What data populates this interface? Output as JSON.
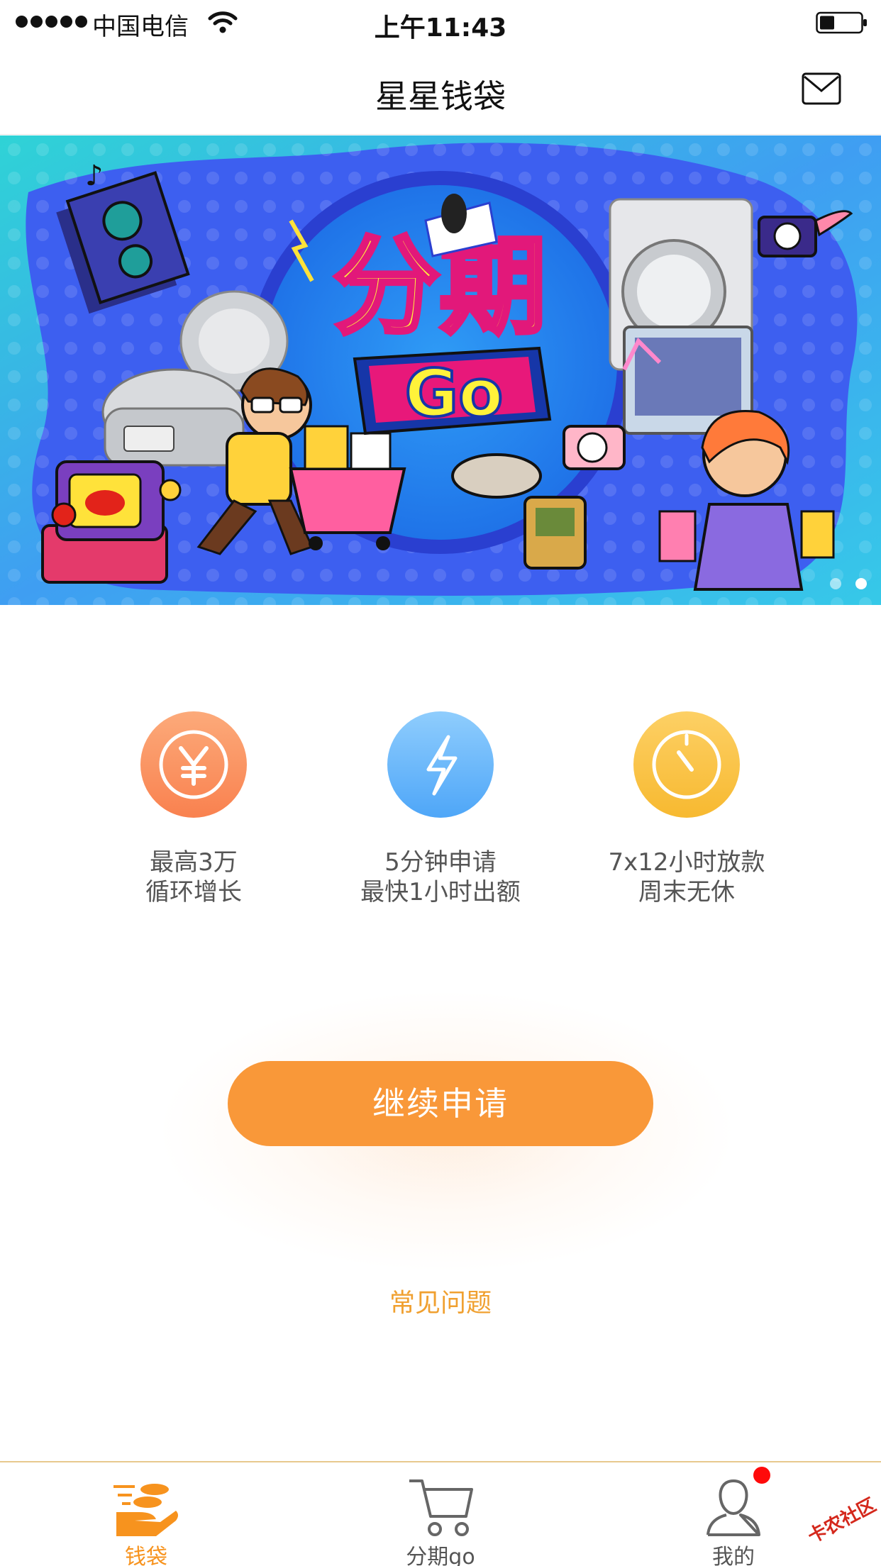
{
  "status_bar": {
    "carrier": "中国电信",
    "time": "上午11:43"
  },
  "nav": {
    "title": "星星钱袋"
  },
  "banner": {
    "headline": "分期",
    "subheadline": "Go",
    "page_count": 2,
    "active_page": 2
  },
  "features": [
    {
      "icon": "yen-icon",
      "line1": "最高3万",
      "line2": "循环增长",
      "color_top": "#fcaa7a",
      "color_bottom": "#f9814f"
    },
    {
      "icon": "lightning-icon",
      "line1": "5分钟申请",
      "line2": "最快1小时出额",
      "color_top": "#8fcdfd",
      "color_bottom": "#4ea6f8"
    },
    {
      "icon": "timer-icon",
      "line1": "7x12小时放款",
      "line2": "周末无休",
      "color_top": "#fdd065",
      "color_bottom": "#f7b930"
    }
  ],
  "cta": {
    "label": "继续申请"
  },
  "faq": {
    "label": "常见问题"
  },
  "tab_bar": {
    "items": [
      {
        "label": "钱袋",
        "icon": "wallet-icon",
        "active": true
      },
      {
        "label": "分期go",
        "icon": "cart-icon",
        "active": false
      },
      {
        "label": "我的",
        "icon": "user-icon",
        "active": false,
        "badge": true
      }
    ]
  },
  "watermark": {
    "text": "卡农社区"
  },
  "colors": {
    "accent": "#f99839",
    "faq": "#f0a030",
    "tab_active": "#f7931e",
    "badge": "#ff0a0a"
  }
}
